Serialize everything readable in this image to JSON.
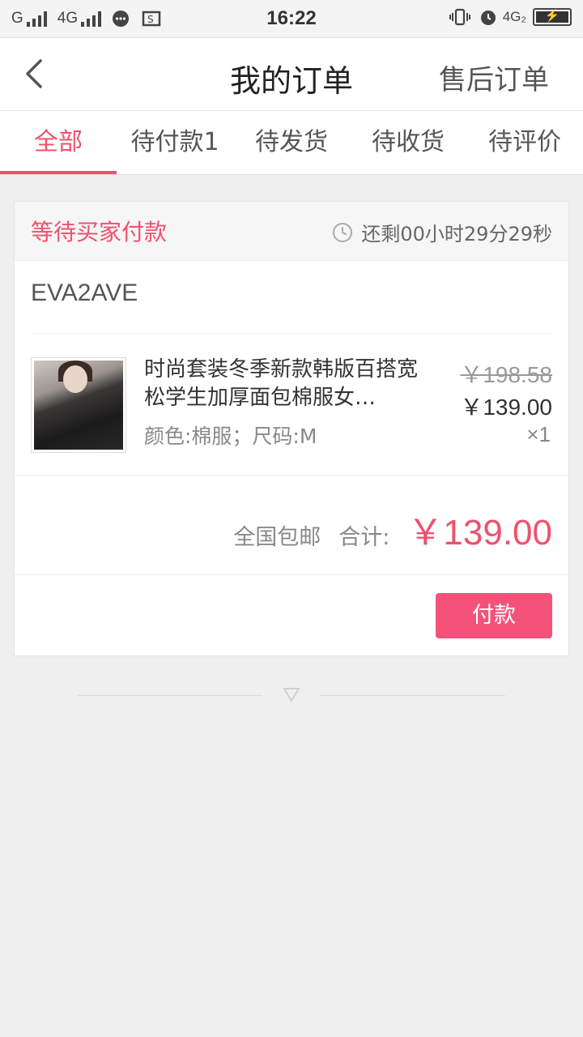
{
  "statusbar": {
    "carrier1": "G",
    "carrier2": "4G",
    "time": "16:22",
    "network": "4G₂"
  },
  "header": {
    "title": "我的订单",
    "aftersale_label": "售后订单"
  },
  "tabs": [
    {
      "label": "全部",
      "active": true
    },
    {
      "label": "待付款1",
      "active": false
    },
    {
      "label": "待发货",
      "active": false
    },
    {
      "label": "待收货",
      "active": false
    },
    {
      "label": "待评价",
      "active": false
    }
  ],
  "order": {
    "status": "等待买家付款",
    "countdown": "还剩00小时29分29秒",
    "shop": "EVA2AVE",
    "item": {
      "name": "时尚套装冬季新款韩版百搭宽松学生加厚面包棉服女…",
      "spec": "颜色:棉服；尺码:M",
      "original_price": "￥198.58",
      "price": "￥139.00",
      "quantity": "×1"
    },
    "shipping": "全国包邮",
    "total_label": "合计:",
    "total": "￥139.00",
    "pay_label": "付款"
  },
  "colors": {
    "accent": "#f0506e",
    "button": "#f5527a",
    "background": "#efefef"
  }
}
